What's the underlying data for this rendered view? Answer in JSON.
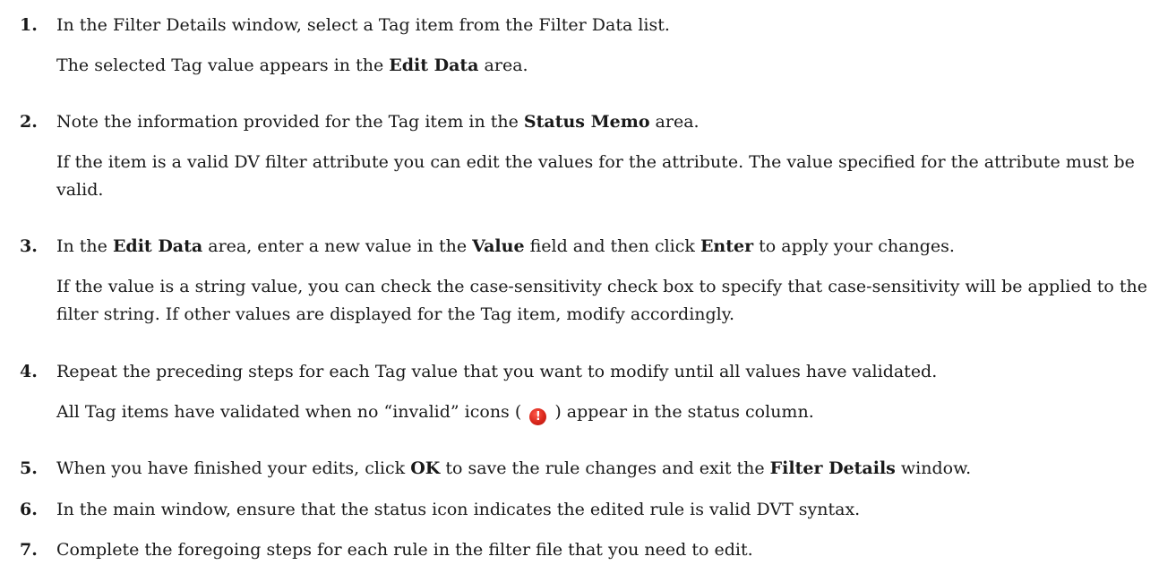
{
  "steps": [
    {
      "number": "1.",
      "line1": "In the Filter Details window, select a Tag item from the Filter Data list.",
      "p2_pre": "The selected Tag value appears in the ",
      "p2_bold": "Edit Data",
      "p2_post": " area."
    },
    {
      "number": "2.",
      "p1_pre": "Note the information provided for the Tag item in the ",
      "p1_bold": "Status Memo",
      "p1_post": " area.",
      "p2": "If the item is a valid DV filter attribute you can edit the values for the attribute. The value specified for the attribute must be valid."
    },
    {
      "number": "3.",
      "p1_a": "In the ",
      "p1_b": "Edit Data",
      "p1_c": " area, enter a new value in the ",
      "p1_d": "Value",
      "p1_e": " field and then click ",
      "p1_f": "Enter",
      "p1_g": " to apply your changes.",
      "p2": "If the value is a string value, you can check the case-sensitivity check box to specify that case-sensitivity will be applied to the filter string. If other values are displayed for the Tag item, modify accordingly."
    },
    {
      "number": "4.",
      "line1": "Repeat the preceding steps for each Tag value that you want to modify until all values have validated.",
      "p2_pre": "All Tag items have validated when no “invalid” icons (",
      "p2_icon": "invalid-icon",
      "p2_post": ") appear in the status column."
    },
    {
      "number": "5.",
      "p1_a": "When you have finished your edits, click ",
      "p1_b": "OK",
      "p1_c": " to save the rule changes and exit the ",
      "p1_d": "Filter Details",
      "p1_e": " window."
    },
    {
      "number": "6.",
      "line1": "In the main window, ensure that the status icon indicates the edited rule is valid DVT syntax."
    },
    {
      "number": "7.",
      "line1": "Complete the foregoing steps for each rule in the filter file that you need to edit."
    }
  ],
  "icons": {
    "invalid_glyph": "!",
    "invalid_color": "#d8261b"
  }
}
